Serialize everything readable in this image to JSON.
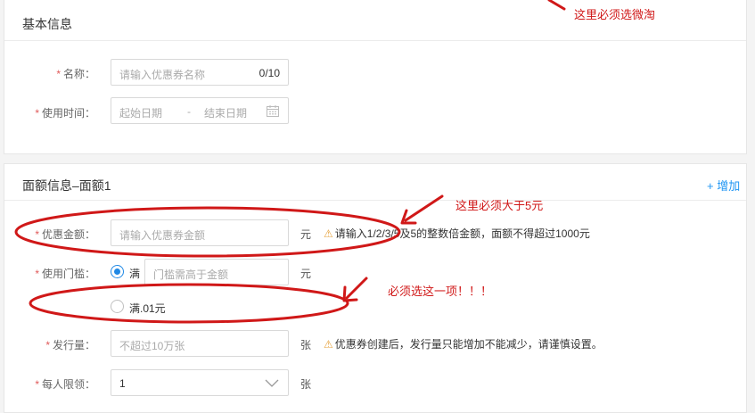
{
  "annotations": {
    "top": "这里必须选微淘",
    "amount": "这里必须大于5元",
    "threshold": "必须选这一项！！！"
  },
  "colors": {
    "annotation": "#d01818",
    "accent": "#1e88e5",
    "warning": "#e6a23c"
  },
  "basic_info": {
    "title": "基本信息",
    "name": {
      "label": "名称：",
      "placeholder": "请输入优惠券名称",
      "counter": "0/10"
    },
    "time": {
      "label": "使用时间：",
      "start_placeholder": "起始日期",
      "separator": "-",
      "end_placeholder": "结束日期",
      "icon": "calendar-icon"
    }
  },
  "denomination": {
    "title": "面额信息–面额1",
    "add_label": "+ 增加",
    "amount": {
      "label": "优惠金额：",
      "placeholder": "请输入优惠券金额",
      "unit": "元",
      "hint": "请输入1/2/3/5及5的整数倍金额，面额不得超过1000元"
    },
    "threshold": {
      "label": "使用门槛：",
      "option1_label": "满",
      "option1_placeholder": "门槛需高于金额",
      "unit": "元",
      "option2_label": "满.01元",
      "selected": "option1"
    },
    "issue": {
      "label": "发行量：",
      "placeholder": "不超过10万张",
      "unit": "张",
      "hint": "优惠券创建后，发行量只能增加不能减少，请谨慎设置。"
    },
    "limit": {
      "label": "每人限领：",
      "value": "1",
      "unit": "张"
    }
  }
}
